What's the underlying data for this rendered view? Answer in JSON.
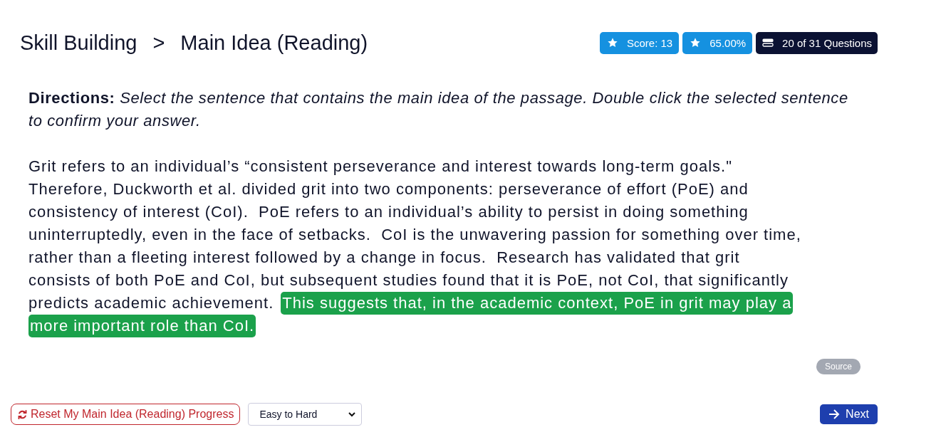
{
  "breadcrumb": {
    "section": "Skill Building",
    "separator": ">",
    "page": "Main Idea (Reading)"
  },
  "badges": [
    {
      "kind": "score",
      "text": "Score: 13"
    },
    {
      "kind": "percent",
      "text": "65.00%"
    },
    {
      "kind": "progress",
      "text": "20 of 31 Questions"
    }
  ],
  "directions": {
    "label": "Directions:",
    "text": "Select the sentence that contains the main idea of the passage. Double click the selected sentence to confirm your answer."
  },
  "passage_lines": [
    {
      "segments": [
        {
          "text": "Grit refers to an individual’s “consistent perseverance and interest towards long-term goals.\"",
          "selected": false
        }
      ]
    },
    {
      "segments": [
        {
          "text": "Therefore, Duckworth et al. divided grit into two components: perseverance of effort (PoE) and",
          "selected": false
        }
      ]
    },
    {
      "segments": [
        {
          "text": "consistency of interest (CoI).  PoE refers to an individual’s ability to persist in doing something",
          "selected": false
        }
      ]
    },
    {
      "segments": [
        {
          "text": "uninterruptedly, even in the face of setbacks.  CoI is the unwavering passion for something over time,",
          "selected": false
        }
      ]
    },
    {
      "segments": [
        {
          "text": "rather than a fleeting interest followed by a change in focus.  Research has validated that grit",
          "selected": false
        }
      ]
    },
    {
      "segments": [
        {
          "text": "consists of both PoE and CoI, but subsequent studies found that it is PoE, not CoI, that significantly",
          "selected": false
        }
      ]
    },
    {
      "segments": [
        {
          "text": "predicts academic achievement.",
          "selected": false
        },
        {
          "text": "This suggests that, in the academic context, PoE in grit may play a",
          "selected": true
        }
      ]
    },
    {
      "segments": [
        {
          "text": "more important role than CoI.",
          "selected": true
        }
      ]
    }
  ],
  "source_button": "Source",
  "reset_button": "Reset My Main Idea (Reading) Progress",
  "order_select": {
    "value": "Easy to Hard"
  },
  "next_button": "Next"
}
